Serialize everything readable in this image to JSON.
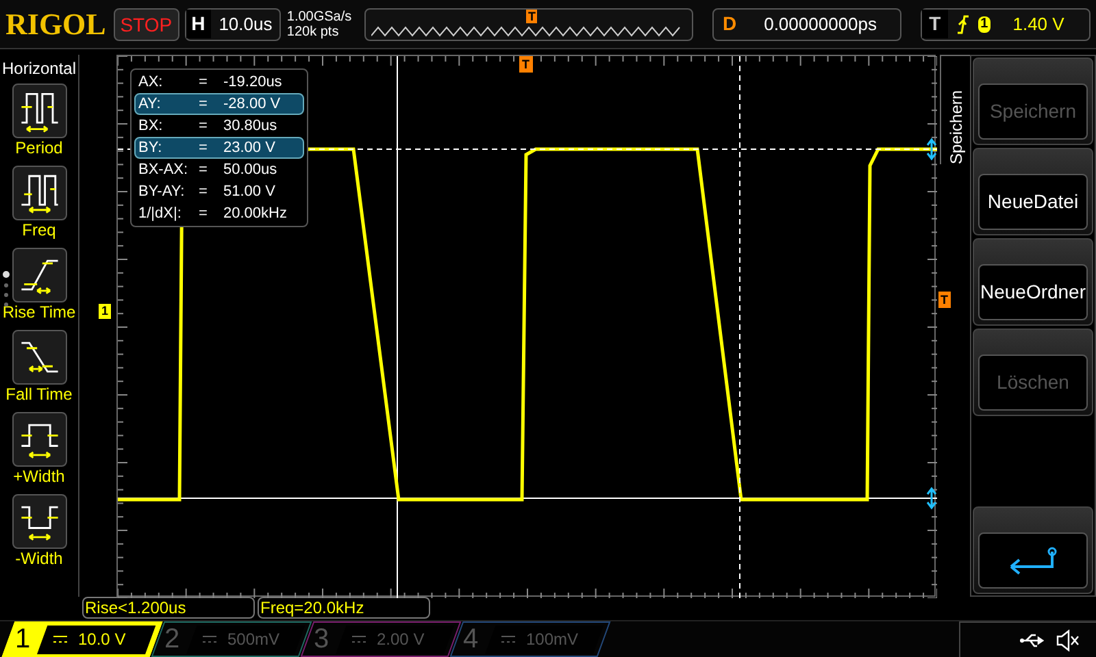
{
  "top_bar": {
    "logo": "RIGOL",
    "run_state": "STOP",
    "timebase": {
      "label": "H",
      "value": "10.0us"
    },
    "sample_rate": "1.00GSa/s",
    "memory_depth": "120k pts",
    "overview_marker": "T",
    "delay": {
      "label": "D",
      "value": "0.00000000ps"
    },
    "trigger": {
      "label": "T",
      "channel": "1",
      "level": "1.40 V"
    }
  },
  "left_menu": {
    "title": "Horizontal",
    "items": [
      {
        "label": "Period",
        "kind": "period"
      },
      {
        "label": "Freq",
        "kind": "freq"
      },
      {
        "label": "Rise Time",
        "kind": "rise"
      },
      {
        "label": "Fall Time",
        "kind": "fall"
      },
      {
        "label": "+Width",
        "kind": "pwidth"
      },
      {
        "label": "-Width",
        "kind": "nwidth"
      }
    ],
    "page_dots": [
      {
        "selected": true
      },
      {
        "selected": false
      },
      {
        "selected": false
      },
      {
        "selected": false
      }
    ]
  },
  "cursor_readout": [
    {
      "label": "AX:",
      "separator": "=",
      "value": "-19.20us",
      "selected": false
    },
    {
      "label": "AY:",
      "separator": "=",
      "value": "-28.00 V",
      "selected": true
    },
    {
      "label": "BX:",
      "separator": "=",
      "value": "30.80us",
      "selected": false
    },
    {
      "label": "BY:",
      "separator": "=",
      "value": "23.00 V",
      "selected": true
    },
    {
      "label": "BX-AX:",
      "separator": "=",
      "value": "50.00us",
      "selected": false
    },
    {
      "label": "BY-AY:",
      "separator": "=",
      "value": "51.00 V",
      "selected": false
    },
    {
      "label": "1/|dX|:",
      "separator": "=",
      "value": "20.00kHz",
      "selected": false
    }
  ],
  "channel_marker": "1",
  "trigger_position_marker": "T",
  "trigger_level_marker": "T",
  "measurements": [
    "Rise<1.200us",
    "Freq=20.0kHz"
  ],
  "right_menu": {
    "title": "Speichern",
    "buttons": [
      {
        "kind": "text",
        "label": "Speichern",
        "disabled": true
      },
      {
        "kind": "text",
        "label": "NeueDatei",
        "disabled": false
      },
      {
        "kind": "text",
        "label": "NeueOrdner",
        "disabled": false
      },
      {
        "kind": "text",
        "label": "Löschen",
        "disabled": true
      },
      {
        "kind": "spacer"
      },
      {
        "kind": "back"
      }
    ]
  },
  "channels": [
    {
      "number": "1",
      "scale": "10.0 V",
      "on": true,
      "color": "#ffff00"
    },
    {
      "number": "2",
      "scale": "500mV",
      "on": false,
      "color": "#1f6b62"
    },
    {
      "number": "3",
      "scale": "2.00 V",
      "on": false,
      "color": "#7a1f6e"
    },
    {
      "number": "4",
      "scale": "100mV",
      "on": false,
      "color": "#24497a"
    }
  ]
}
